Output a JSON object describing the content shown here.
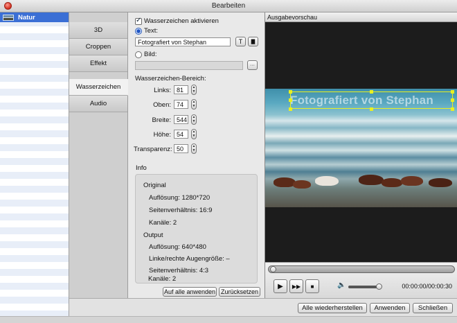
{
  "window": {
    "title": "Bearbeiten"
  },
  "file_list": {
    "items": [
      {
        "label": "Natur",
        "selected": true
      }
    ]
  },
  "tabs": [
    {
      "label": "3D",
      "active": false
    },
    {
      "label": "Croppen",
      "active": false
    },
    {
      "label": "Effekt",
      "active": false
    },
    {
      "label": "Wasserzeichen",
      "active": true
    },
    {
      "label": "Audio",
      "active": false
    }
  ],
  "watermark": {
    "enable_label": "Wasserzeichen aktivieren",
    "enabled": true,
    "text_option_label": "Text:",
    "text_value": "Fotografiert von Stephan",
    "text_btn_font": "T",
    "text_btn_color": "▇",
    "image_option_label": "Bild:",
    "image_value": "",
    "browse_label": "···",
    "area_label": "Wasserzeichen-Bereich:",
    "fields": [
      {
        "label": "Links:",
        "value": "81"
      },
      {
        "label": "Oben:",
        "value": "74"
      },
      {
        "label": "Breite:",
        "value": "544"
      },
      {
        "label": "Höhe:",
        "value": "54"
      },
      {
        "label": "Transparenz:",
        "value": "50"
      }
    ]
  },
  "info": {
    "title": "Info",
    "original_label": "Original",
    "original_lines": [
      "Auflösung: 1280*720",
      "Seitenverhältnis: 16:9",
      "Kanäle: 2"
    ],
    "output_label": "Output",
    "output_lines": [
      "Auflösung: 640*480",
      "Linke/rechte Augengröße: –",
      "Seitenverhältnis: 4:3",
      "Kanäle: 2"
    ]
  },
  "panel_buttons": {
    "apply_all": "Auf alle anwenden",
    "reset": "Zurücksetzen"
  },
  "preview": {
    "title": "Ausgabevorschau",
    "watermark_text": "Fotografiert von Stephan",
    "time": "00:00:00/00:00:30",
    "timeline_progress": 0.0,
    "volume": 0.95
  },
  "bottom_buttons": {
    "restore_all": "Alle wiederherstellen",
    "apply": "Anwenden",
    "close": "Schließen"
  },
  "colors": {
    "selection": "#3b6fd5",
    "watermark_box": "#e9f020",
    "preview_bg": "#1c1c1c"
  }
}
